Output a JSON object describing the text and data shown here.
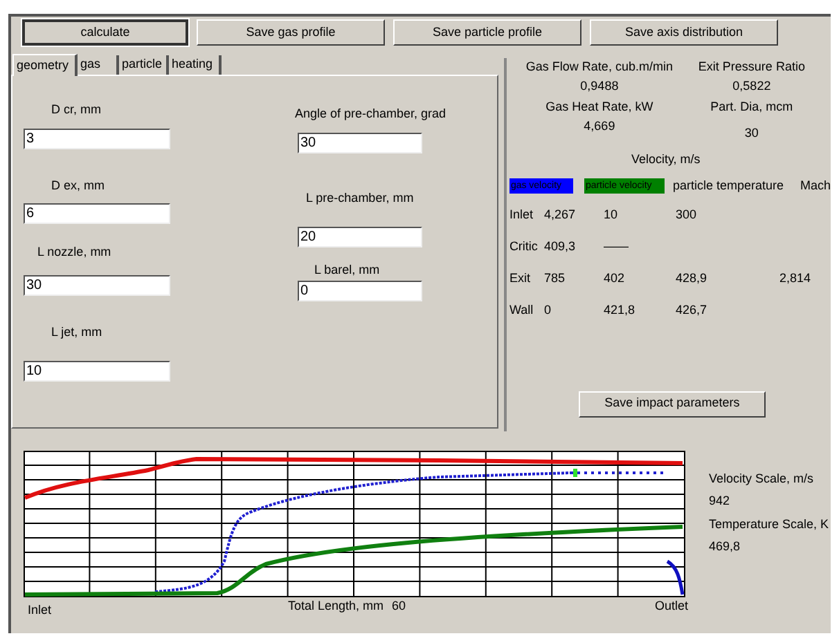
{
  "toolbar_buttons": [
    {
      "label": "calculate",
      "focused": true
    },
    {
      "label": "Save gas profile",
      "focused": false
    },
    {
      "label": "Save particle profile",
      "focused": false
    },
    {
      "label": "Save axis distribution",
      "focused": false
    }
  ],
  "tabs": [
    {
      "label": "geometry",
      "selected": true
    },
    {
      "label": "gas",
      "selected": false
    },
    {
      "label": "particle",
      "selected": false
    },
    {
      "label": "heating",
      "selected": false
    }
  ],
  "fields_left": [
    {
      "label": "D cr, mm",
      "value": "3"
    },
    {
      "label": "D ex, mm",
      "value": "6"
    },
    {
      "label": "L nozzle, mm",
      "value": "30"
    },
    {
      "label": "L jet, mm",
      "value": "10"
    }
  ],
  "fields_right": [
    {
      "label": "Angle of pre-chamber, grad",
      "value": "30"
    },
    {
      "label": "L pre-chamber, mm",
      "value": "20"
    },
    {
      "label": "L barel, mm",
      "value": "0"
    }
  ],
  "readouts": [
    {
      "label": "Gas Flow Rate, cub.m/min",
      "value": "0,9488"
    },
    {
      "label": "Exit Pressure Ratio",
      "value": "0,5822"
    },
    {
      "label": "Gas Heat Rate, kW",
      "value": "4,669"
    },
    {
      "label": "Part. Dia, mcm",
      "value": "30"
    }
  ],
  "velocity_title": "Velocity, m/s",
  "legend": [
    {
      "kind": "swatch",
      "label": "gas velocity",
      "color": "#0000ff"
    },
    {
      "kind": "swatch",
      "label": "particle velocity",
      "color": "#008000"
    },
    {
      "kind": "text",
      "label": "particle temperature"
    },
    {
      "kind": "text",
      "label": "Mach"
    }
  ],
  "rows": [
    {
      "name": "Inlet",
      "cells": [
        "4,267",
        "10",
        "300"
      ]
    },
    {
      "name": "Critic",
      "cells": [
        "409,3",
        "——"
      ]
    },
    {
      "name": "Exit",
      "cells": [
        "785",
        "402",
        "428,9",
        "2,814"
      ]
    },
    {
      "name": "Wall",
      "cells": [
        "0",
        "421,8",
        "426,7"
      ]
    }
  ],
  "impact_button": "Save impact parameters",
  "scales": [
    {
      "label": "Velocity Scale, m/s",
      "value": "942"
    },
    {
      "label": "Temperature Scale, K",
      "value": "469,8"
    }
  ],
  "axis": {
    "start": "Inlet",
    "length_label": "Total Length, mm",
    "length": "60",
    "end": "Outlet"
  }
}
